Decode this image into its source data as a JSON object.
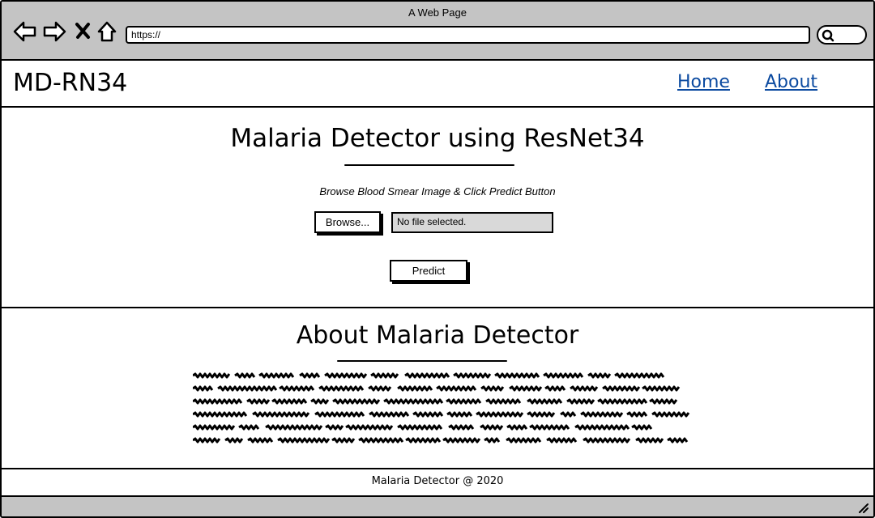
{
  "browser": {
    "window_title": "A Web Page",
    "url": "https://"
  },
  "icons": [
    "back-arrow-icon",
    "forward-arrow-icon",
    "close-x-icon",
    "home-icon",
    "search-icon",
    "resize-grip-icon"
  ],
  "header": {
    "logo": "MD-RN34",
    "nav": {
      "home": "Home",
      "about": "About"
    },
    "link_color": "#0b4aa0"
  },
  "hero": {
    "title": "Malaria Detector using ResNet34",
    "instruction": "Browse Blood Smear Image & Click Predict Button",
    "browse_label": "Browse...",
    "file_status": "No file selected.",
    "predict_label": "Predict"
  },
  "about": {
    "title": "About Malaria Detector",
    "body_placeholder_lines": 6
  },
  "footer": {
    "text": "Malaria Detector @ 2020"
  },
  "colors": {
    "chrome": "#c4c4c4",
    "file_field": "#d9d9d9"
  }
}
